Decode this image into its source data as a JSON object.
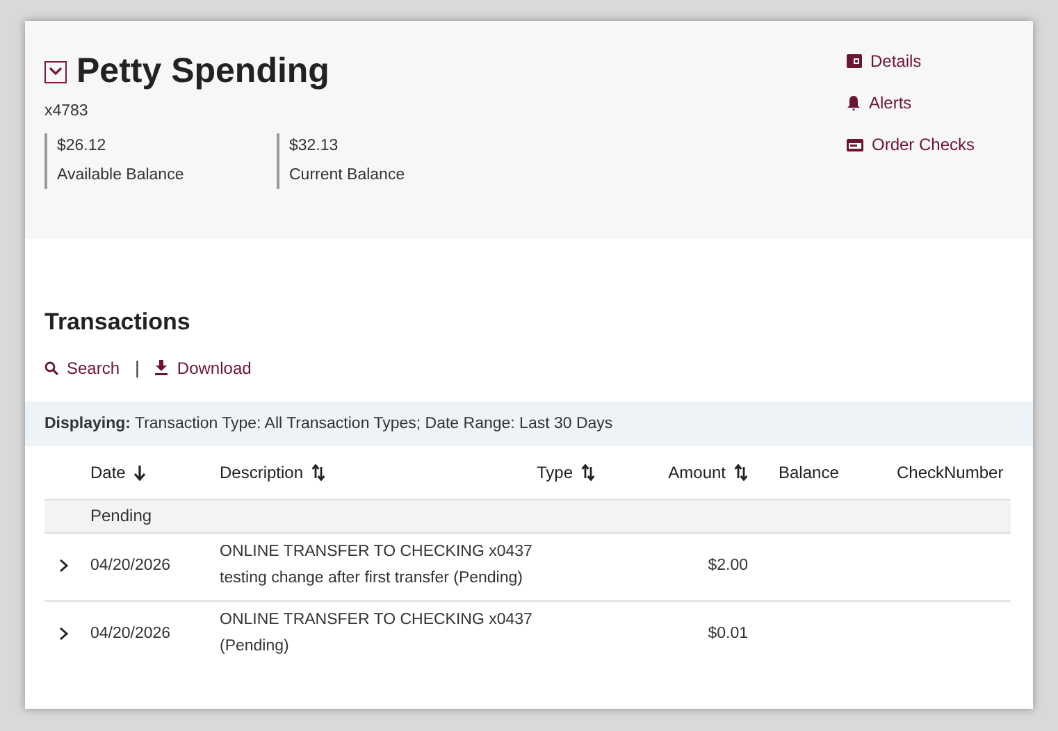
{
  "account": {
    "title": "Petty Spending",
    "number": "x4783",
    "balances": [
      {
        "amount": "$26.12",
        "label": "Available Balance"
      },
      {
        "amount": "$32.13",
        "label": "Current Balance"
      }
    ]
  },
  "actions": [
    {
      "kind": "details",
      "label": "Details"
    },
    {
      "kind": "alerts",
      "label": "Alerts"
    },
    {
      "kind": "checks",
      "label": "Order Checks"
    }
  ],
  "transactions": {
    "title": "Transactions",
    "tools": [
      {
        "kind": "search",
        "label": "Search"
      },
      {
        "kind": "download",
        "label": "Download"
      }
    ],
    "separator": "|",
    "filter": "**Displaying:** Transaction Type: All Transaction Types; Date Range: Last 30 Days",
    "columns": [
      {
        "label": "Date",
        "sortable": true,
        "sorted": true,
        "numeric": false
      },
      {
        "label": "Description",
        "sortable": true,
        "sorted": false,
        "numeric": false
      },
      {
        "label": "Type",
        "sortable": true,
        "sorted": false,
        "numeric": false
      },
      {
        "label": "Amount",
        "sortable": true,
        "sorted": false,
        "numeric": true
      },
      {
        "label": "Balance",
        "sortable": false,
        "numeric": false
      },
      {
        "label": "CheckNumber",
        "sortable": false,
        "numeric": false
      }
    ],
    "group": "Pending",
    "rows": [
      {
        "date": "04/20/2026",
        "description": [
          "ONLINE TRANSFER TO CHECKING x0437",
          "testing change after first transfer (Pending)"
        ],
        "amount": "$2.00",
        "expanded": false
      },
      {
        "date": "04/20/2026",
        "description": [
          "ONLINE TRANSFER TO CHECKING x0437",
          "(Pending)"
        ],
        "amount": "$0.01",
        "expanded": false
      }
    ]
  }
}
